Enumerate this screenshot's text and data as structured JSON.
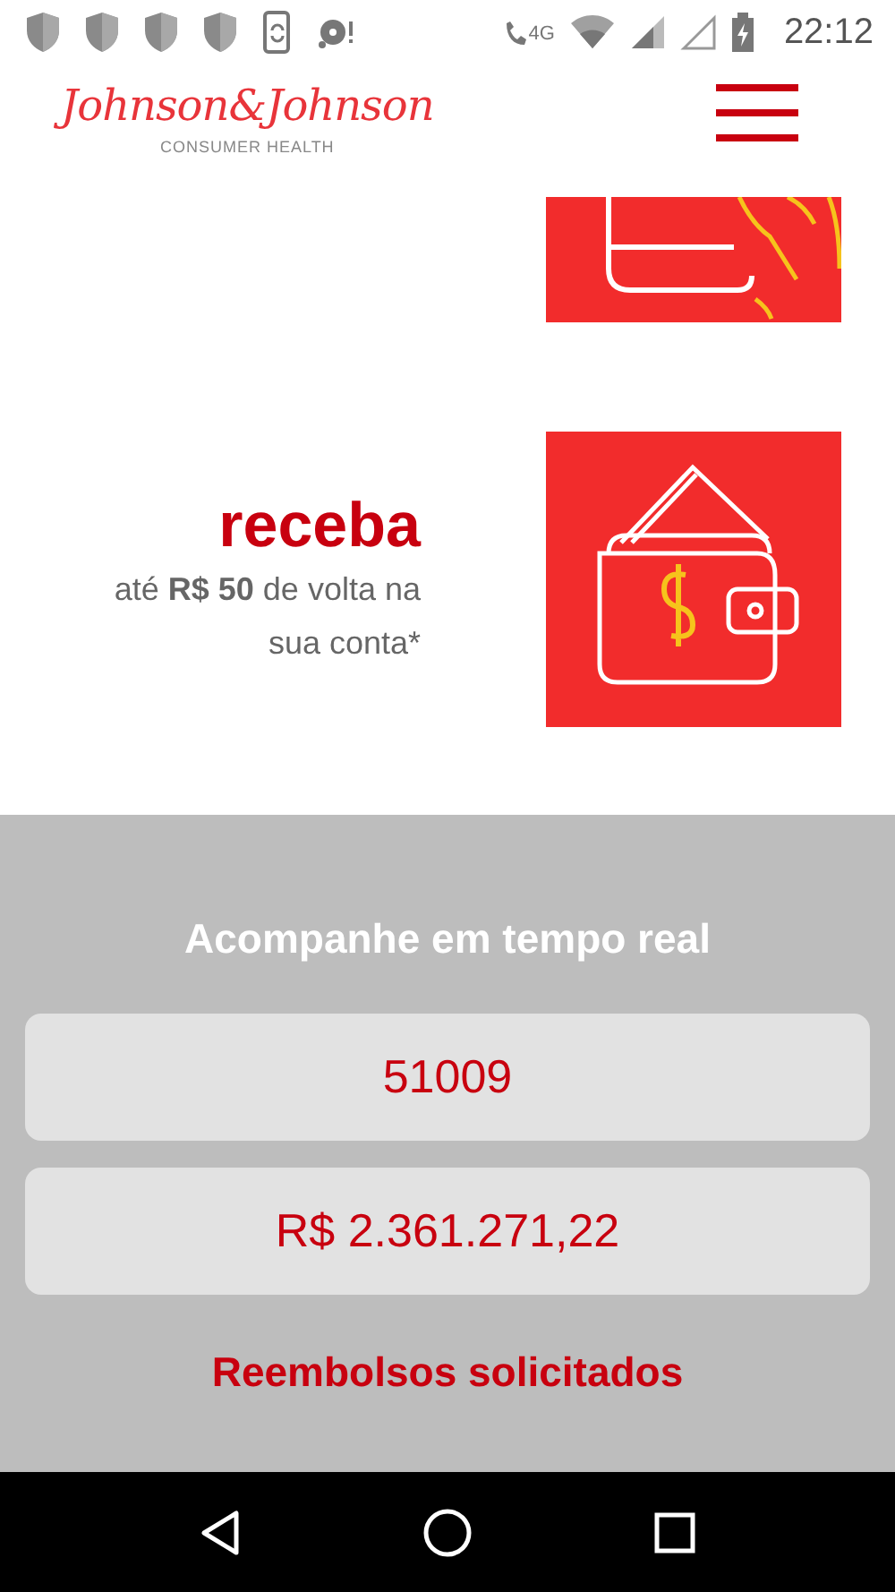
{
  "status_bar": {
    "network": "4G",
    "time": "22:12"
  },
  "header": {
    "logo": "Johnson&Johnson",
    "logo_subtitle": "CONSUMER HEALTH"
  },
  "promo": {
    "headline": "receba",
    "text": "até **R$ 50** de volta na sua conta*"
  },
  "tracker": {
    "title": "Acompanhe em tempo real",
    "counters": [
      "51009",
      "R$ 2.361.271,22"
    ],
    "caption": "Reembolsos solicitados"
  }
}
